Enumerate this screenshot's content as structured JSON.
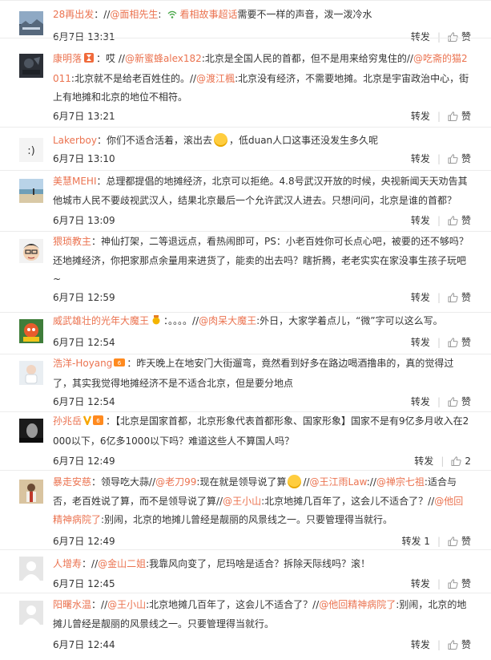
{
  "actions": {
    "forward": "转发",
    "like": "赞"
  },
  "comments": [
    {
      "user": "28再出发",
      "colon": "：",
      "parts": [
        {
          "t": "text",
          "v": "//"
        },
        {
          "t": "link",
          "v": "@面相先生"
        },
        {
          "t": "text",
          "v": ":"
        },
        {
          "t": "verify"
        },
        {
          "t": "link",
          "v": "看相故事超话"
        },
        {
          "t": "text",
          "v": "需要不一样的声音，泼一泼冷水"
        }
      ],
      "time": "6月7日 13:31",
      "forward": "转发",
      "like": "赞",
      "avatar_icon": "landscape-avatar-icon",
      "badge": null
    },
    {
      "user": "康明落",
      "colon": "：",
      "parts": [
        {
          "t": "text",
          "v": "哎 //"
        },
        {
          "t": "link",
          "v": "@新蜜蜂alex182"
        },
        {
          "t": "text",
          "v": ":北京是全国人民的首都，但不是用来给穷鬼住的//"
        },
        {
          "t": "link",
          "v": "@吃斋的猫2011"
        },
        {
          "t": "text",
          "v": ":北京就不是给老百姓住的。//"
        },
        {
          "t": "link",
          "v": "@渡江楓"
        },
        {
          "t": "text",
          "v": ":北京没有经济，不需要地摊。北京是宇宙政治中心，街上有地摊和北京的地位不相符。"
        }
      ],
      "time": "6月7日 13:21",
      "forward": "转发",
      "like": "赞",
      "avatar_icon": "dark-scene-avatar-icon",
      "badge": "hourglass-badge-icon"
    },
    {
      "user": "Lakerboy",
      "colon": "：",
      "parts": [
        {
          "t": "text",
          "v": "你们不适合活着，滚出去"
        },
        {
          "t": "emoji"
        },
        {
          "t": "text",
          "v": "，低duan人口这事还没发生多久呢"
        }
      ],
      "time": "6月7日 13:10",
      "forward": "转发",
      "like": "赞",
      "avatar_icon": "smiley-text-avatar-icon",
      "badge": null
    },
    {
      "user": "美慧MEHI",
      "colon": "：",
      "parts": [
        {
          "t": "text",
          "v": "总理都提倡的地摊经济，北京可以拒绝。4.8号武汉开放的时候，央视新闻天天劝告其他城市人民不要歧视武汉人，结果北京最后一个允许武汉人进去。只想问问，北京是谁的首都？"
        }
      ],
      "time": "6月7日 13:09",
      "forward": "转发",
      "like": "赞",
      "avatar_icon": "beach-avatar-icon",
      "badge": null
    },
    {
      "user": "猥琐教主",
      "colon": "：",
      "parts": [
        {
          "t": "text",
          "v": "神仙打架，二等退远点，看热闹即可，PS：小老百姓你可长点心吧，被要的还不够吗？还地摊经济，你把家那点余量用来进货了，能卖的出去吗？瞎折腾，老老实实在家没事生孩子玩吧~"
        }
      ],
      "time": "6月7日 12:59",
      "forward": "转发",
      "like": "赞",
      "avatar_icon": "cartoon-face-avatar-icon",
      "badge": null
    },
    {
      "user": "威武雄壮的光年大魔王",
      "colon": "：",
      "parts": [
        {
          "t": "text",
          "v": "。。。。//"
        },
        {
          "t": "link",
          "v": "@肉呆大魔王"
        },
        {
          "t": "text",
          "v": ":外日，大家学着点儿，“微”字可以这么写。"
        }
      ],
      "time": "6月7日 12:54",
      "forward": "转发",
      "like": "赞",
      "avatar_icon": "colorful-avatar-icon",
      "badge": "medal-badge-icon"
    },
    {
      "user": "浩洋-Hoyang",
      "colon": "：",
      "parts": [
        {
          "t": "text",
          "v": "昨天晚上在地安门大街遛弯，竟然看到好多在路边喝酒撸串的，真的觉得过了，其实我觉得地摊经济不是不适合北京，但是要分地点"
        }
      ],
      "time": "6月7日 12:54",
      "forward": "转发",
      "like": "赞",
      "avatar_icon": "child-avatar-icon",
      "badge": "level-badge-icon"
    },
    {
      "user": "孙兆岳",
      "colon": "：",
      "parts": [
        {
          "t": "text",
          "v": "【北京是国家首都，北京形象代表首都形象、国家形象】国家不是有9亿多月收入在2000以下，6亿多1000以下吗？难道这些人不算国人吗？"
        }
      ],
      "time": "6月7日 12:49",
      "forward": "转发",
      "like": "2",
      "avatar_icon": "portrait-avatar-icon",
      "badge": "v-badge-icon"
    },
    {
      "user": "暴走安慈",
      "colon": "：",
      "parts": [
        {
          "t": "text",
          "v": "领导吃大蒜//"
        },
        {
          "t": "link",
          "v": "@老刀99"
        },
        {
          "t": "text",
          "v": ":现在就是领导说了算"
        },
        {
          "t": "emoji"
        },
        {
          "t": "text",
          "v": "//"
        },
        {
          "t": "link",
          "v": "@王江雨Law"
        },
        {
          "t": "text",
          "v": "://"
        },
        {
          "t": "link",
          "v": "@禅宗七祖"
        },
        {
          "t": "text",
          "v": ":适合与否，老百姓说了算，而不是领导说了算//"
        },
        {
          "t": "link",
          "v": "@王小山"
        },
        {
          "t": "text",
          "v": ":北京地摊几百年了，这会儿不适合了？//"
        },
        {
          "t": "link",
          "v": "@他回精神病院了"
        },
        {
          "t": "text",
          "v": ":别闹，北京的地摊儿曾经是靓丽的风景线之一。只要管理得当就行。"
        }
      ],
      "time": "6月7日 12:49",
      "forward": "转发 1",
      "like": "赞",
      "avatar_icon": "performer-avatar-icon",
      "badge": null
    },
    {
      "user": "人增寿",
      "colon": "：",
      "parts": [
        {
          "t": "text",
          "v": "//"
        },
        {
          "t": "link",
          "v": "@金山二姐"
        },
        {
          "t": "text",
          "v": ":我靠风向变了，尼玛啥是适合？拆除天际线吗？滚！"
        }
      ],
      "time": "6月7日 12:45",
      "forward": "转发",
      "like": "赞",
      "avatar_icon": "default-user-avatar-icon",
      "badge": null
    },
    {
      "user": "阳曙水温",
      "colon": "：",
      "parts": [
        {
          "t": "text",
          "v": "//"
        },
        {
          "t": "link",
          "v": "@王小山"
        },
        {
          "t": "text",
          "v": ":北京地摊几百年了，这会儿不适合了？//"
        },
        {
          "t": "link",
          "v": "@他回精神病院了"
        },
        {
          "t": "text",
          "v": ":别闹，北京的地摊儿曾经是靓丽的风景线之一。只要管理得当就行。"
        }
      ],
      "time": "6月7日 12:44",
      "forward": "转发",
      "like": "赞",
      "avatar_icon": "default-user-avatar-icon",
      "badge": null
    }
  ]
}
